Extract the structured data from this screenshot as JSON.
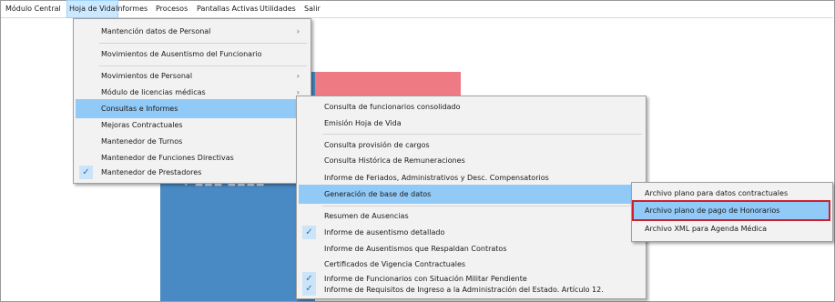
{
  "menubar": {
    "items": [
      "Módulo Central",
      "Hoja de Vida",
      "Informes",
      "Procesos",
      "Pantallas Activas",
      "Utilidades",
      "Salir"
    ]
  },
  "menu1": {
    "items": [
      {
        "label": "Mantención datos de Personal",
        "has_submenu": true
      },
      {
        "label": "Movimientos de Ausentismo del Funcionario",
        "has_submenu": false
      },
      {
        "label": "Movimientos de Personal",
        "has_submenu": true
      },
      {
        "label": "Módulo de licencias médicas",
        "has_submenu": true
      },
      {
        "label": "Consultas e Informes",
        "has_submenu": true,
        "highlighted": true
      },
      {
        "label": "Mejoras Contractuales",
        "has_submenu": true
      },
      {
        "label": "Mantenedor de Turnos",
        "has_submenu": false
      },
      {
        "label": "Mantenedor de Funciones Directivas",
        "has_submenu": false
      },
      {
        "label": "Mantenedor de Prestadores",
        "has_submenu": false,
        "checked": true
      }
    ]
  },
  "menu2": {
    "items": [
      {
        "label": "Consulta de funcionarios consolidado"
      },
      {
        "label": "Emisión Hoja de Vida"
      },
      {
        "label": "Consulta provisión de cargos"
      },
      {
        "label": "Consulta Histórica de Remuneraciones"
      },
      {
        "label": "Informe de Feriados, Administrativos y Desc. Compensatorios"
      },
      {
        "label": "Generación de base de datos",
        "has_submenu": true,
        "highlighted": true
      },
      {
        "label": "Resumen de Ausencias"
      },
      {
        "label": "Informe de ausentismo detallado",
        "checked": true
      },
      {
        "label": "Informe de Ausentismos que Respaldan Contratos"
      },
      {
        "label": "Certificados de Vigencia Contractuales"
      },
      {
        "label": "Informe de Funcionarios con Situación Militar Pendiente",
        "checked": true
      },
      {
        "label": "Informe de Requisitos de Ingreso a la Administración del Estado. Artículo 12.",
        "checked": true
      }
    ]
  },
  "menu3": {
    "items": [
      {
        "label": "Archivo plano para datos contractuales"
      },
      {
        "label": "Archivo plano de pago de Honorarios",
        "highlighted": true,
        "outlined": true
      },
      {
        "label": "Archivo XML para Agenda Médica"
      }
    ]
  },
  "icons": {
    "submenu_arrow": "›",
    "check": "✓"
  },
  "colors": {
    "menu_highlight": "#91c9f7",
    "active_menubar": "#cce8ff",
    "annotation_box": "#cf1f2e",
    "background_blue": "#4a8ac4",
    "background_red": "#ee7b84"
  }
}
